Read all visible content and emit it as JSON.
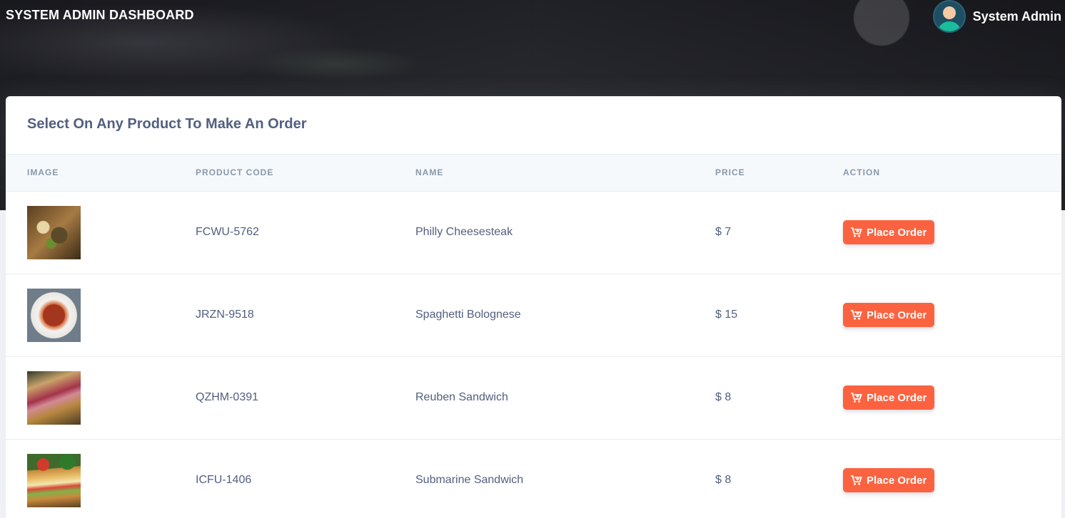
{
  "header": {
    "title": "SYSTEM ADMIN DASHBOARD",
    "user_name": "System Admin"
  },
  "card": {
    "title": "Select On Any Product To Make An Order"
  },
  "table": {
    "columns": [
      "IMAGE",
      "PRODUCT CODE",
      "NAME",
      "PRICE",
      "ACTION"
    ],
    "rows": [
      {
        "code": "FCWU-5762",
        "name": "Philly Cheesesteak",
        "price": "$ 7",
        "action": "Place Order"
      },
      {
        "code": "JRZN-9518",
        "name": "Spaghetti Bolognese",
        "price": "$ 15",
        "action": "Place Order"
      },
      {
        "code": "QZHM-0391",
        "name": "Reuben Sandwich",
        "price": "$ 8",
        "action": "Place Order"
      },
      {
        "code": "ICFU-1406",
        "name": "Submarine Sandwich",
        "price": "$ 8",
        "action": "Place Order"
      }
    ]
  },
  "icons": {
    "action_icon": "cart-plus-icon",
    "avatar_icon": "user-avatar"
  },
  "colors": {
    "accent": "#fb6340",
    "text": "#525f7f",
    "header_text": "#8898aa"
  }
}
